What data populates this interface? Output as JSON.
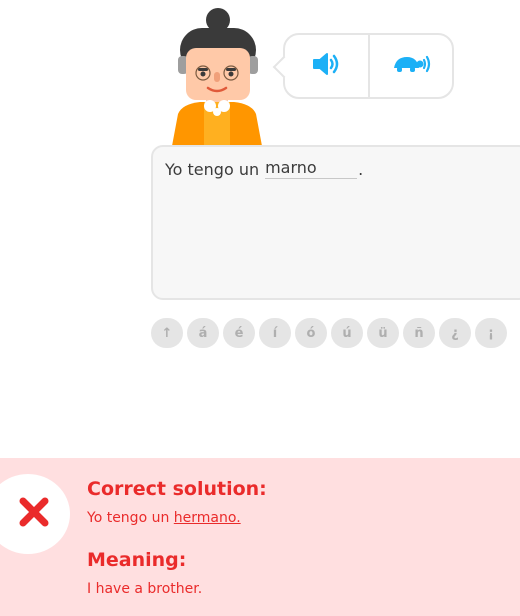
{
  "exercise": {
    "sentence_prefix": "Yo tengo un",
    "typed_answer": "marno",
    "sentence_suffix": "."
  },
  "audio": {
    "normal_icon": "speaker-icon",
    "slow_icon": "turtle-icon"
  },
  "special_keys": [
    "↑",
    "á",
    "é",
    "í",
    "ó",
    "ú",
    "ü",
    "ñ",
    "¿",
    "¡"
  ],
  "feedback": {
    "correct_heading": "Correct solution:",
    "correct_prefix": "Yo tengo un ",
    "correct_highlight": "hermano.",
    "meaning_heading": "Meaning:",
    "meaning_text": "I have a brother.",
    "status_icon": "close-icon"
  },
  "colors": {
    "accent_blue": "#1cb0f6",
    "error_red": "#ea2b2b",
    "feedback_bg": "#ffdfe0",
    "character_orange": "#ff9600"
  }
}
